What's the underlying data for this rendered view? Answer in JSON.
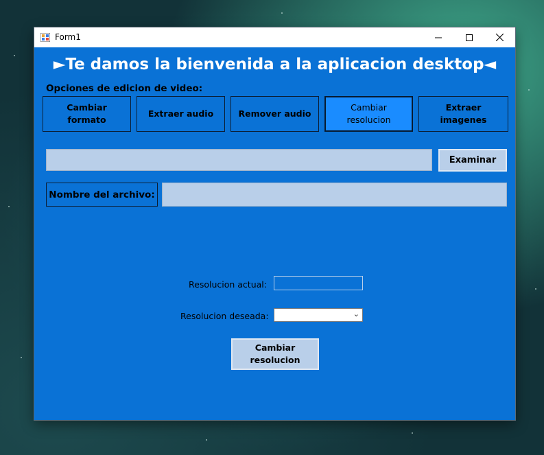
{
  "window": {
    "title": "Form1",
    "controls": {
      "minimize": "—",
      "maximize": "☐",
      "close": "✕"
    }
  },
  "header": {
    "welcome": "►Te damos la bienvenida a la aplicacion desktop◄"
  },
  "options": {
    "label": "Opciones de edicion de video:",
    "tabs": [
      {
        "label": "Cambiar formato"
      },
      {
        "label": "Extraer audio"
      },
      {
        "label": "Remover audio"
      },
      {
        "label": "Cambiar resolucion",
        "active": true
      },
      {
        "label": "Extraer imagenes"
      }
    ]
  },
  "file": {
    "path_value": "",
    "browse_label": "Examinar",
    "name_label": "Nombre del archivo:",
    "name_value": ""
  },
  "resolution": {
    "current_label": "Resolucion actual:",
    "current_value": "",
    "desired_label": "Resolucion deseada:",
    "desired_selected": "",
    "submit_label": "Cambiar resolucion"
  },
  "colors": {
    "form_background": "#0a72d6",
    "active_tab": "#1a8cff",
    "input_fill": "#b9cfe9",
    "title_text": "#ffffff"
  }
}
